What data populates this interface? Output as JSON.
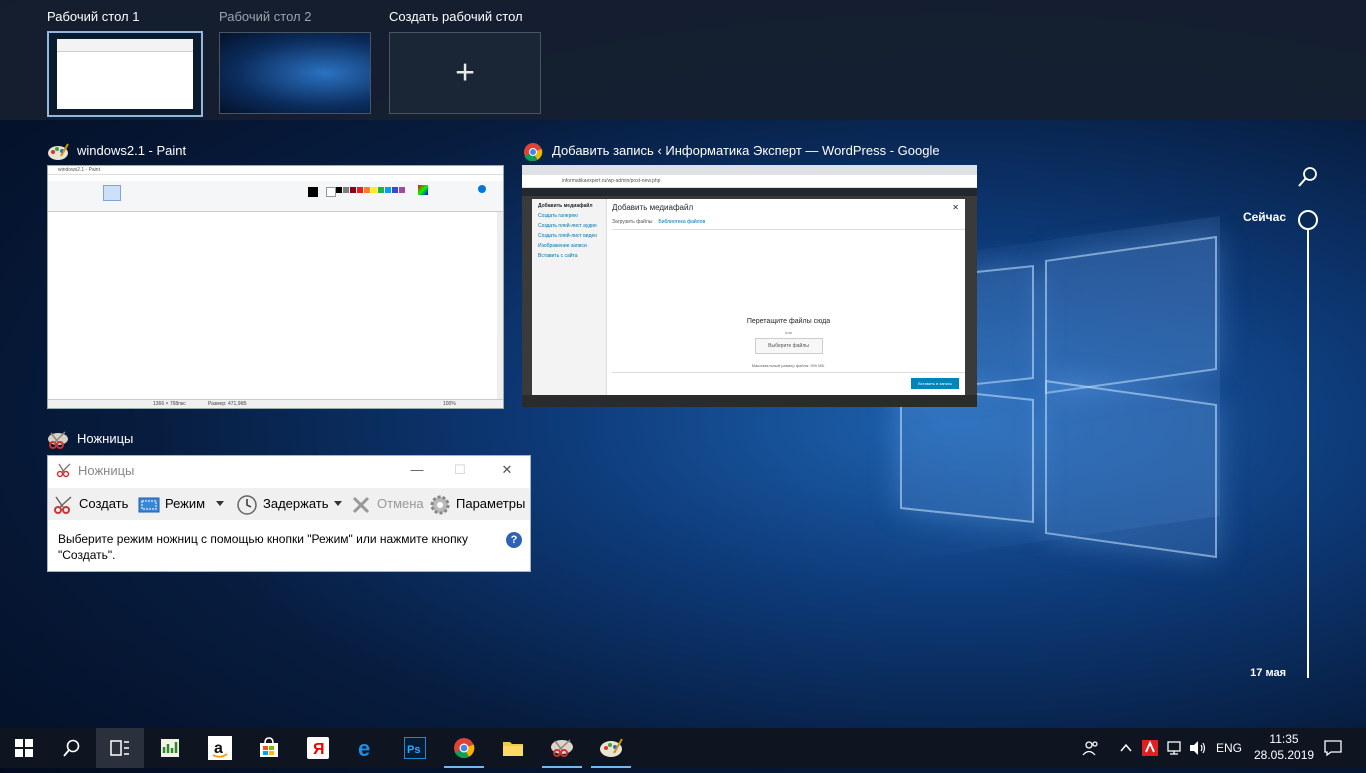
{
  "desktops": [
    {
      "label": "Рабочий стол 1",
      "active": true
    },
    {
      "label": "Рабочий стол 2",
      "active": false
    },
    {
      "label": "Создать рабочий стол",
      "icon": "plus-icon"
    }
  ],
  "windows": {
    "paint": {
      "title": "windows2.1 - Paint",
      "doc_title": "windows2.1 - Paint",
      "status_dims": "1366 × 768пкс",
      "status_size": "Размер: 471,9КБ",
      "zoom": "100%"
    },
    "chrome": {
      "title": "Добавить запись ‹ Информатика Эксперт — WordPress - Google Chr...",
      "url": "informatikaexpert.ru/wp-admin/post-new.php",
      "modal_title": "Добавить медиафайл",
      "sidebar": [
        "Добавить медиафайл",
        "Создать галерею",
        "Создать плей-лист аудио",
        "Создать плей-лист видео",
        "Изображение записи",
        "Вставить с сайта"
      ],
      "tab_upload": "Загрузить файлы",
      "tab_library": "Библиотека файлов",
      "drop_heading": "Перетащите файлы сюда",
      "drop_or": "или",
      "select_button": "Выберите файлы",
      "max_size": "Максимальный размер файла: 999 МБ.",
      "insert_button": "Вставить в запись"
    },
    "snip": {
      "card_title": "Ножницы",
      "title": "Ножницы",
      "new": "Создать",
      "mode": "Режим",
      "delay": "Задержать",
      "cancel": "Отмена",
      "options": "Параметры",
      "message": "Выберите режим ножниц с помощью кнопки \"Режим\" или нажмите кнопку \"Создать\".",
      "help": "?"
    }
  },
  "timeline": {
    "now": "Сейчас",
    "date": "17 мая"
  },
  "taskbar": {
    "apps": [
      "start-icon",
      "search-icon",
      "task-view-icon",
      "spreadsheet-icon",
      "amazon-icon",
      "store-icon",
      "yandex-icon",
      "edge-icon",
      "photoshop-icon",
      "chrome-icon",
      "explorer-icon",
      "snipping-icon",
      "paint-icon"
    ],
    "lang": "ENG",
    "time": "11:35",
    "date": "28.05.2019"
  },
  "colors": {
    "accent": "#76b9ed",
    "wp_blue": "#0085ba",
    "taskbar": "#0e1521"
  }
}
